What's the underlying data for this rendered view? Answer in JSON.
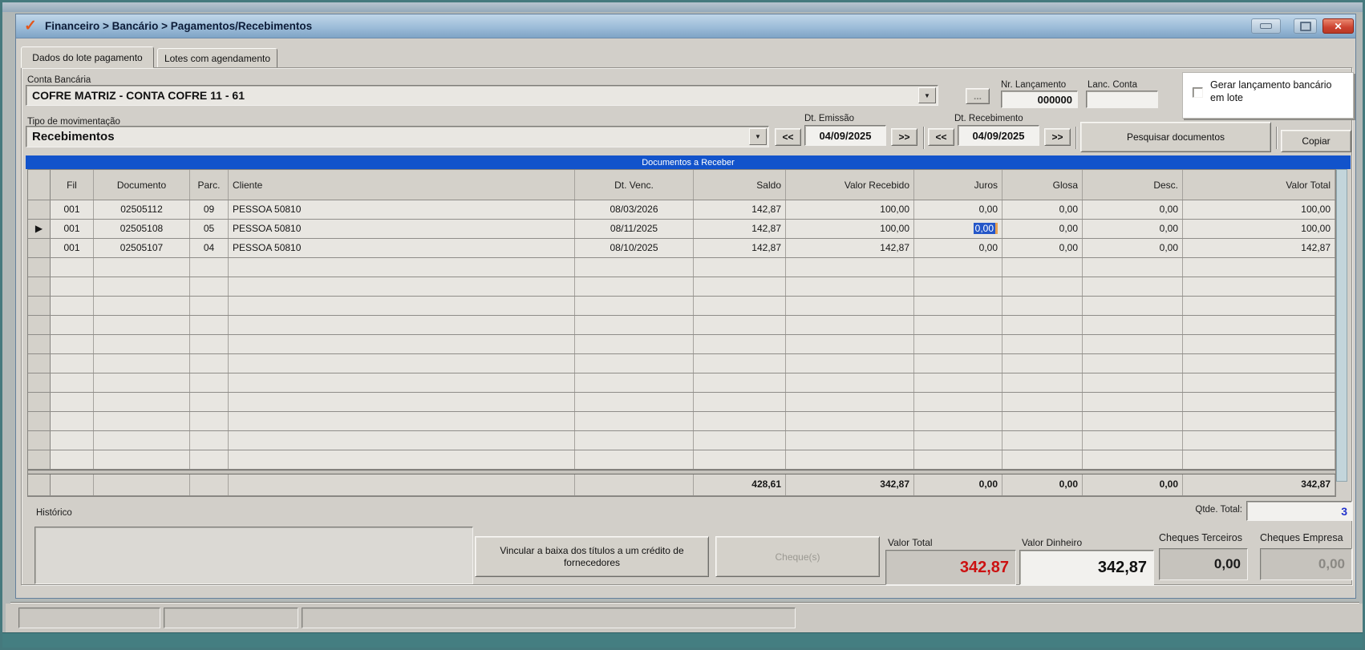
{
  "window": {
    "title": "Financeiro > Bancário > Pagamentos/Recebimentos"
  },
  "icons": {
    "app": "✓",
    "close": "✕",
    "dropdown": "▼",
    "row_selector": "▶"
  },
  "tabs": [
    {
      "label": "Dados do lote pagamento",
      "active": true
    },
    {
      "label": "Lotes com agendamento",
      "active": false
    }
  ],
  "form": {
    "conta_bancaria": {
      "label": "Conta Bancária",
      "value": "COFRE MATRIZ - CONTA COFRE 11 - 61"
    },
    "browse_label": "...",
    "nr_lancamento": {
      "label": "Nr. Lançamento",
      "value": "000000"
    },
    "lanc_conta": {
      "label": "Lanc. Conta",
      "value": ""
    },
    "gerar_lote": {
      "label": "Gerar lançamento bancário em lote",
      "checked": false
    },
    "tipo_movimentacao": {
      "label": "Tipo de movimentação",
      "value": "Recebimentos"
    },
    "nav_prev": "<<",
    "nav_next": ">>",
    "dt_emissao": {
      "label": "Dt. Emissão",
      "value": "04/09/2025"
    },
    "dt_recebimento": {
      "label": "Dt. Recebimento",
      "value": "04/09/2025"
    },
    "pesquisar_label": "Pesquisar documentos",
    "copiar_label": "Copiar"
  },
  "grid": {
    "banner": "Documentos a Receber",
    "columns": [
      "Fil",
      "Documento",
      "Parc.",
      "Cliente",
      "Dt. Venc.",
      "Saldo",
      "Valor Recebido",
      "Juros",
      "Glosa",
      "Desc.",
      "Valor Total"
    ],
    "rows": [
      {
        "fil": "001",
        "documento": "02505112",
        "parc": "09",
        "cliente": "PESSOA 50810",
        "dt_venc": "08/03/2026",
        "saldo": "142,87",
        "valor_recebido": "100,00",
        "juros": "0,00",
        "glosa": "0,00",
        "desc": "0,00",
        "valor_total": "100,00",
        "selected": false
      },
      {
        "fil": "001",
        "documento": "02505108",
        "parc": "05",
        "cliente": "PESSOA 50810",
        "dt_venc": "08/11/2025",
        "saldo": "142,87",
        "valor_recebido": "100,00",
        "juros": "0,00",
        "glosa": "0,00",
        "desc": "0,00",
        "valor_total": "100,00",
        "selected": true,
        "selected_cell": "juros"
      },
      {
        "fil": "001",
        "documento": "02505107",
        "parc": "04",
        "cliente": "PESSOA 50810",
        "dt_venc": "08/10/2025",
        "saldo": "142,87",
        "valor_recebido": "142,87",
        "juros": "0,00",
        "glosa": "0,00",
        "desc": "0,00",
        "valor_total": "142,87",
        "selected": false
      }
    ],
    "empty_row_count": 11,
    "totals": {
      "saldo": "428,61",
      "valor_recebido": "342,87",
      "juros": "0,00",
      "glosa": "0,00",
      "desc": "0,00",
      "valor_total": "342,87"
    }
  },
  "footer": {
    "historico": {
      "label": "Histórico",
      "value": ""
    },
    "qtde_total": {
      "label": "Qtde. Total:",
      "value": "3"
    },
    "vincular_label": "Vincular a baixa dos títulos a um crédito de fornecedores",
    "cheques_label": "Cheque(s)",
    "valor_total": {
      "label": "Valor Total",
      "value": "342,87"
    },
    "valor_dinheiro": {
      "label": "Valor Dinheiro",
      "value": "342,87"
    },
    "cheques_terceiros": {
      "label": "Cheques Terceiros",
      "value": "0,00"
    },
    "cheques_empresa": {
      "label": "Cheques Empresa",
      "value": "0,00"
    }
  },
  "colors": {
    "banner_blue": "#1253cb",
    "selection_blue": "#2456c8",
    "value_red": "#cc1111",
    "qtde_blue": "#2233cc",
    "frame_teal": "#447e81",
    "title_gradient_top": "#c0d6e9",
    "title_gradient_bottom": "#7fa4c6"
  }
}
